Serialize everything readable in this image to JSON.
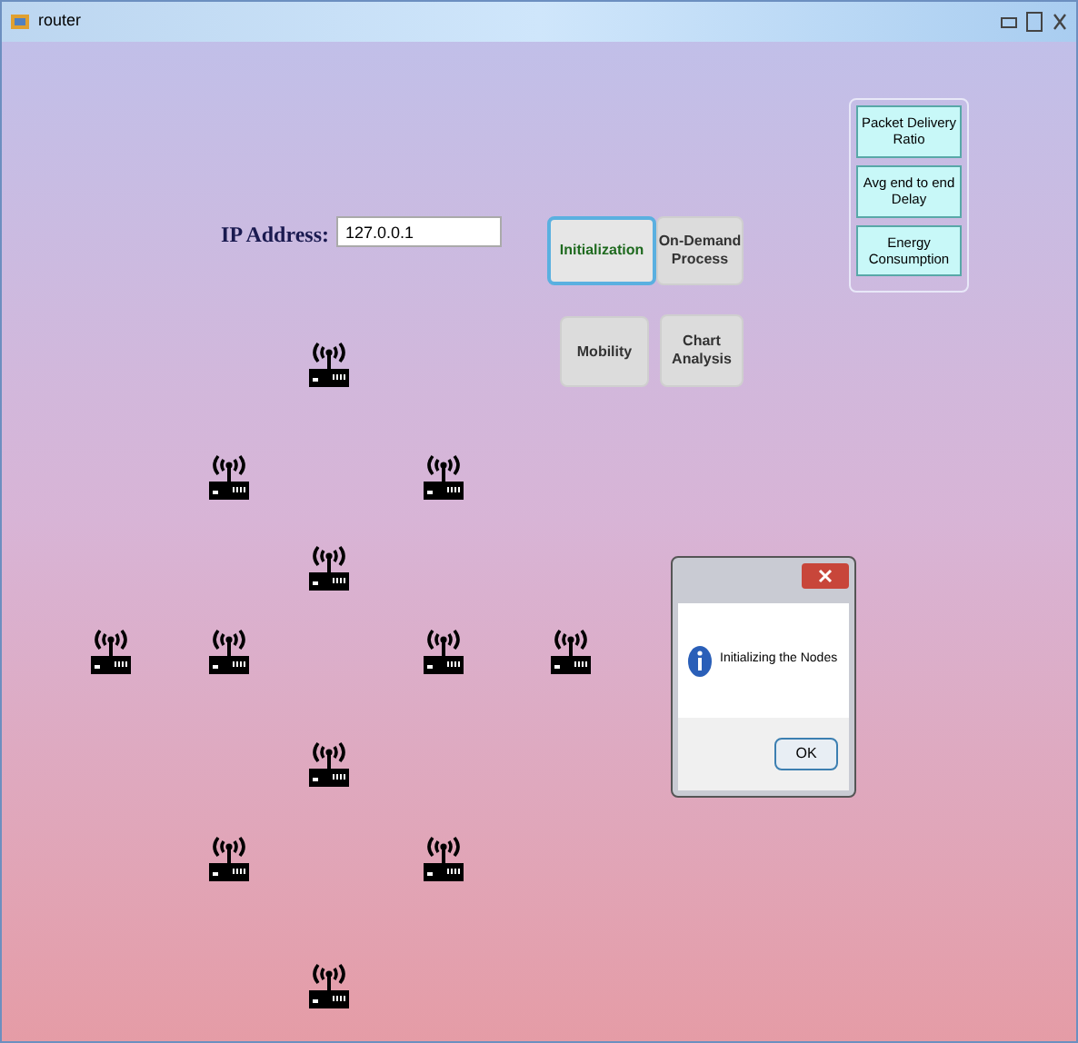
{
  "window": {
    "title": "router"
  },
  "ip_address": {
    "label": "IP Address:",
    "value": "127.0.0.1"
  },
  "buttons": [
    {
      "label": "Initialization",
      "selected": true
    },
    {
      "label": "On-Demand Process",
      "selected": false
    },
    {
      "label": "Mobility",
      "selected": false
    },
    {
      "label": "Chart Analysis",
      "selected": false
    }
  ],
  "metrics_panel": {
    "buttons": [
      "Packet Delivery Ratio",
      "Avg end to end Delay",
      "Energy Consumption"
    ]
  },
  "dialog": {
    "message": "Initializing the Nodes",
    "ok_button": "OK"
  }
}
